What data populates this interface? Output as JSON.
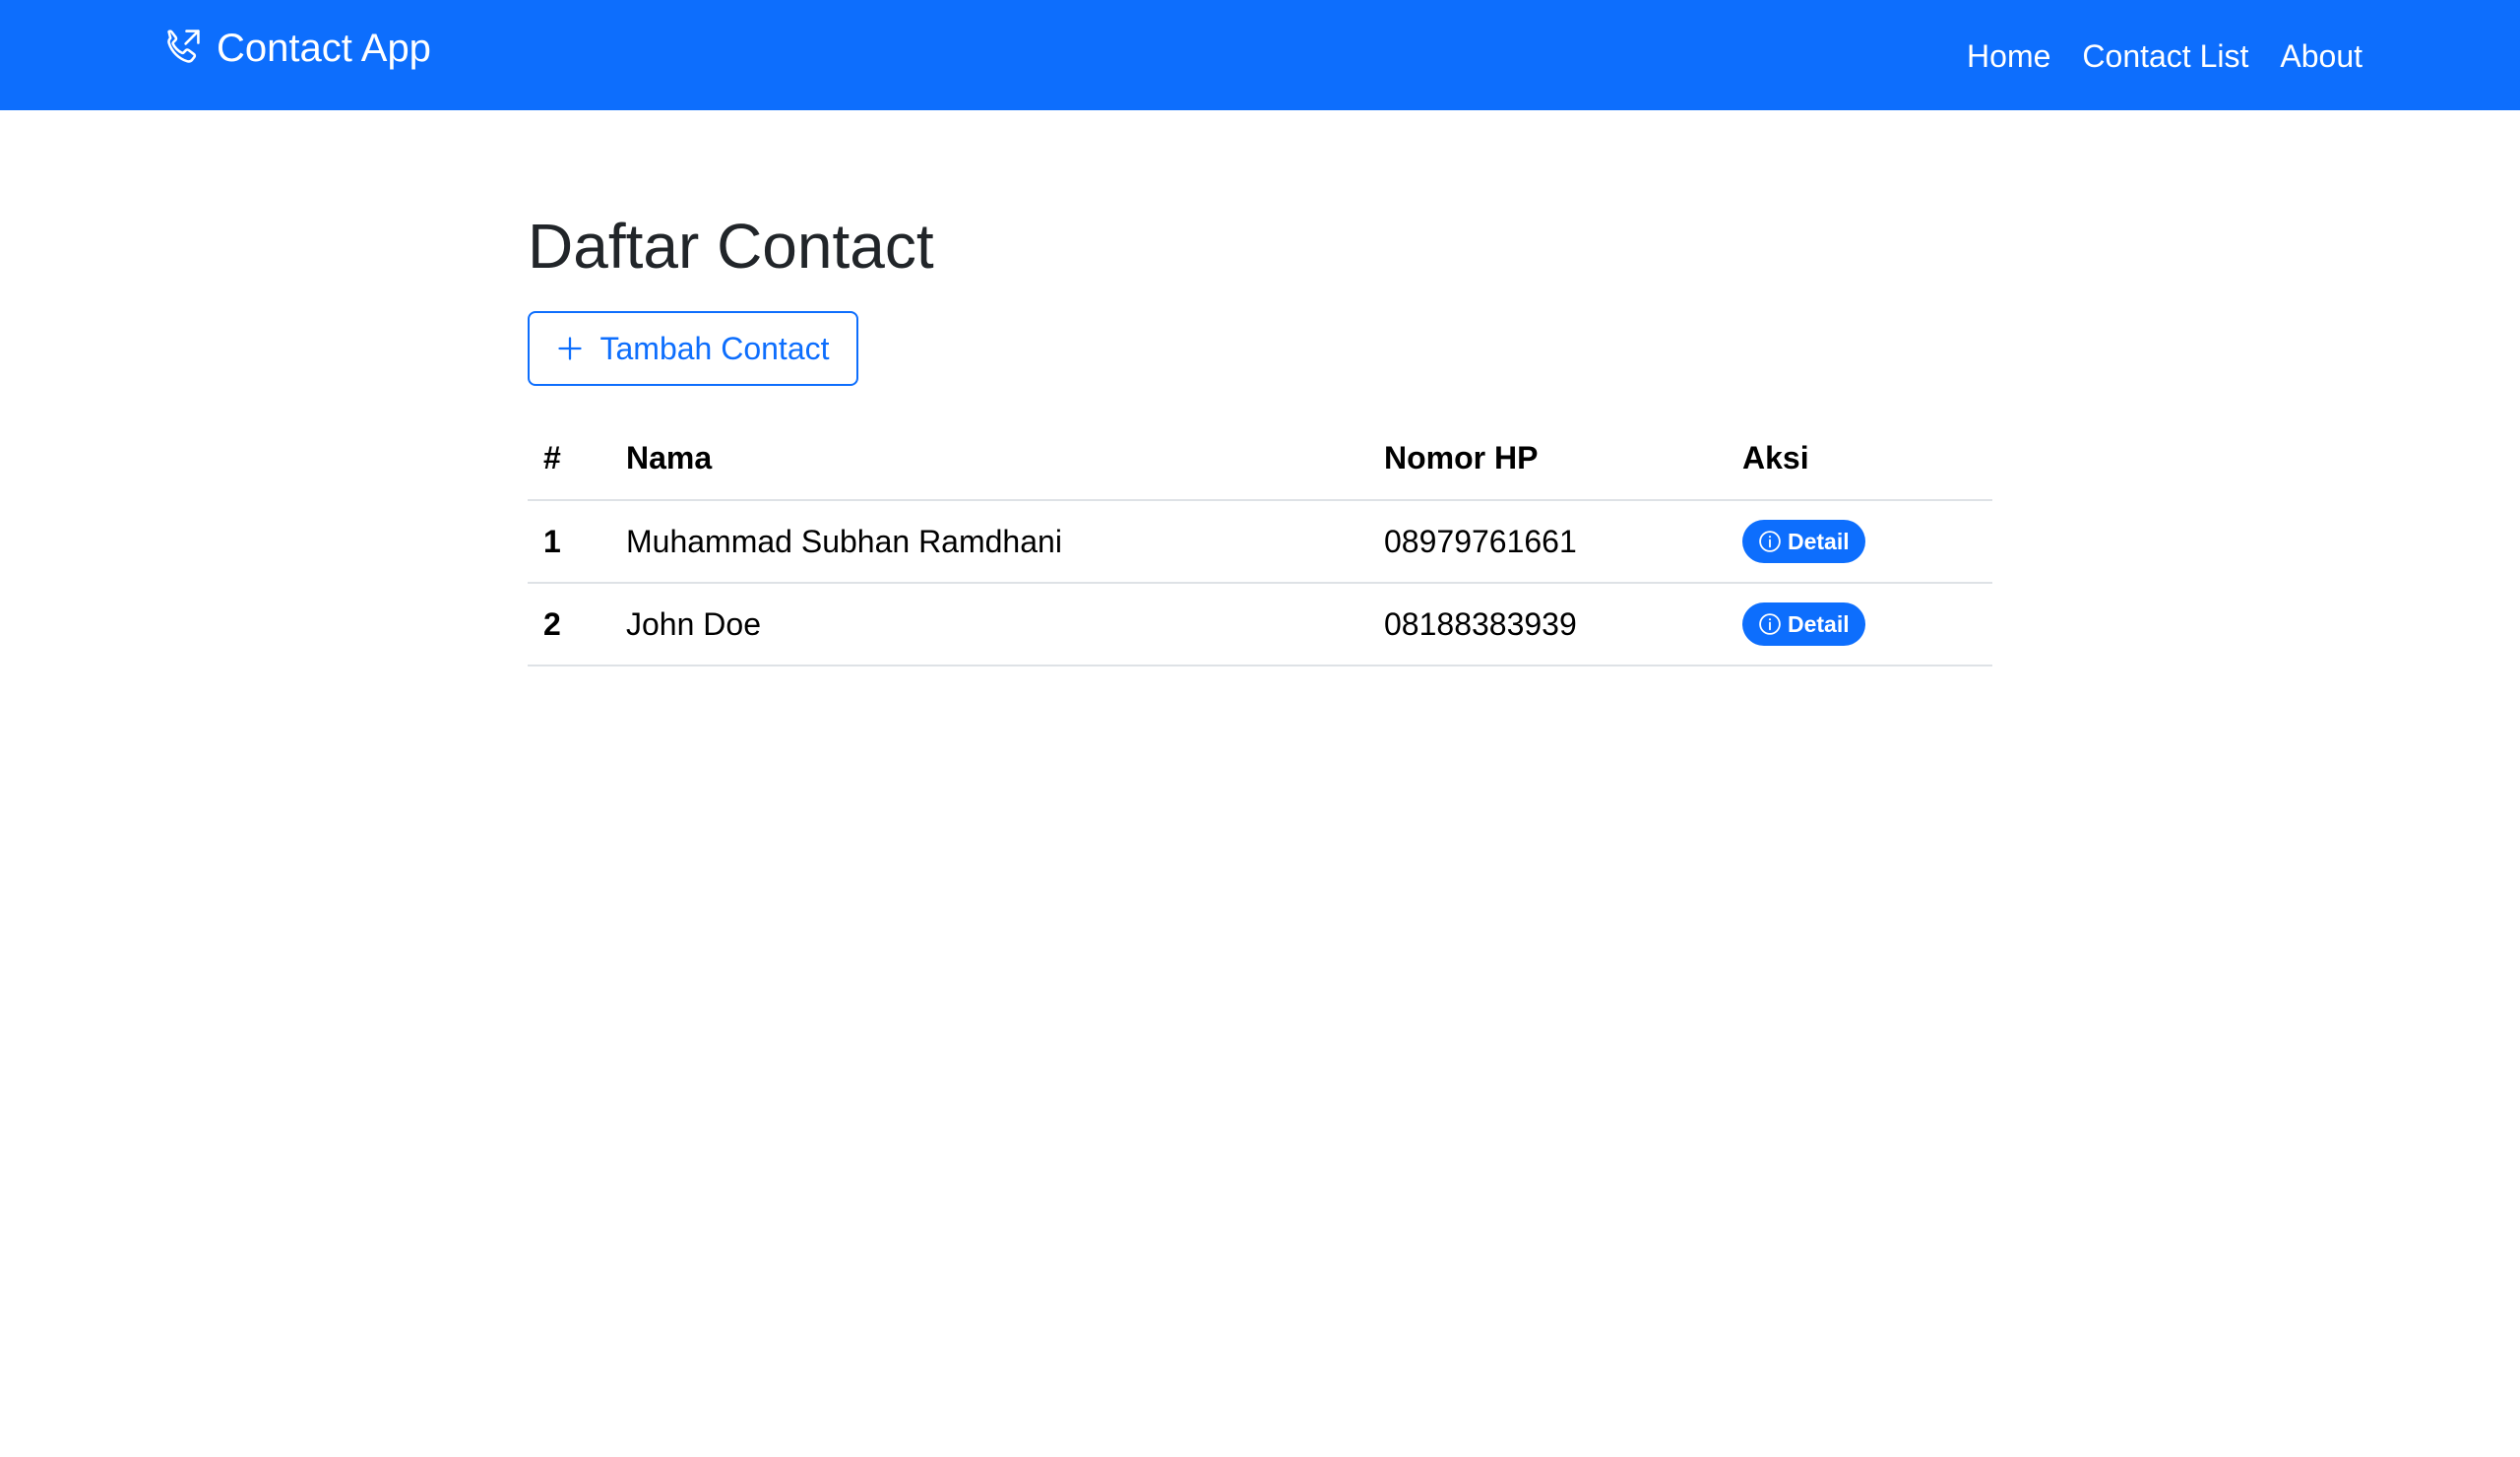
{
  "navbar": {
    "brand": "Contact App",
    "brand_icon": "phone-outgoing-icon",
    "links": [
      "Home",
      "Contact List",
      "About"
    ],
    "background": "#0d6efd"
  },
  "main": {
    "title": "Daftar Contact",
    "add_button": {
      "label": "Tambah Contact",
      "icon": "plus-icon"
    },
    "table": {
      "headers": [
        "#",
        "Nama",
        "Nomor HP",
        "Aksi"
      ],
      "rows": [
        {
          "no": "1",
          "nama": "Muhammad Subhan Ramdhani",
          "hp": "08979761661",
          "action": "Detail"
        },
        {
          "no": "2",
          "nama": "John Doe",
          "hp": "08188383939",
          "action": "Detail"
        }
      ],
      "action_icon": "info-circle-icon"
    }
  },
  "colors": {
    "primary": "#0d6efd",
    "text": "#212529",
    "border": "#dee2e6"
  }
}
